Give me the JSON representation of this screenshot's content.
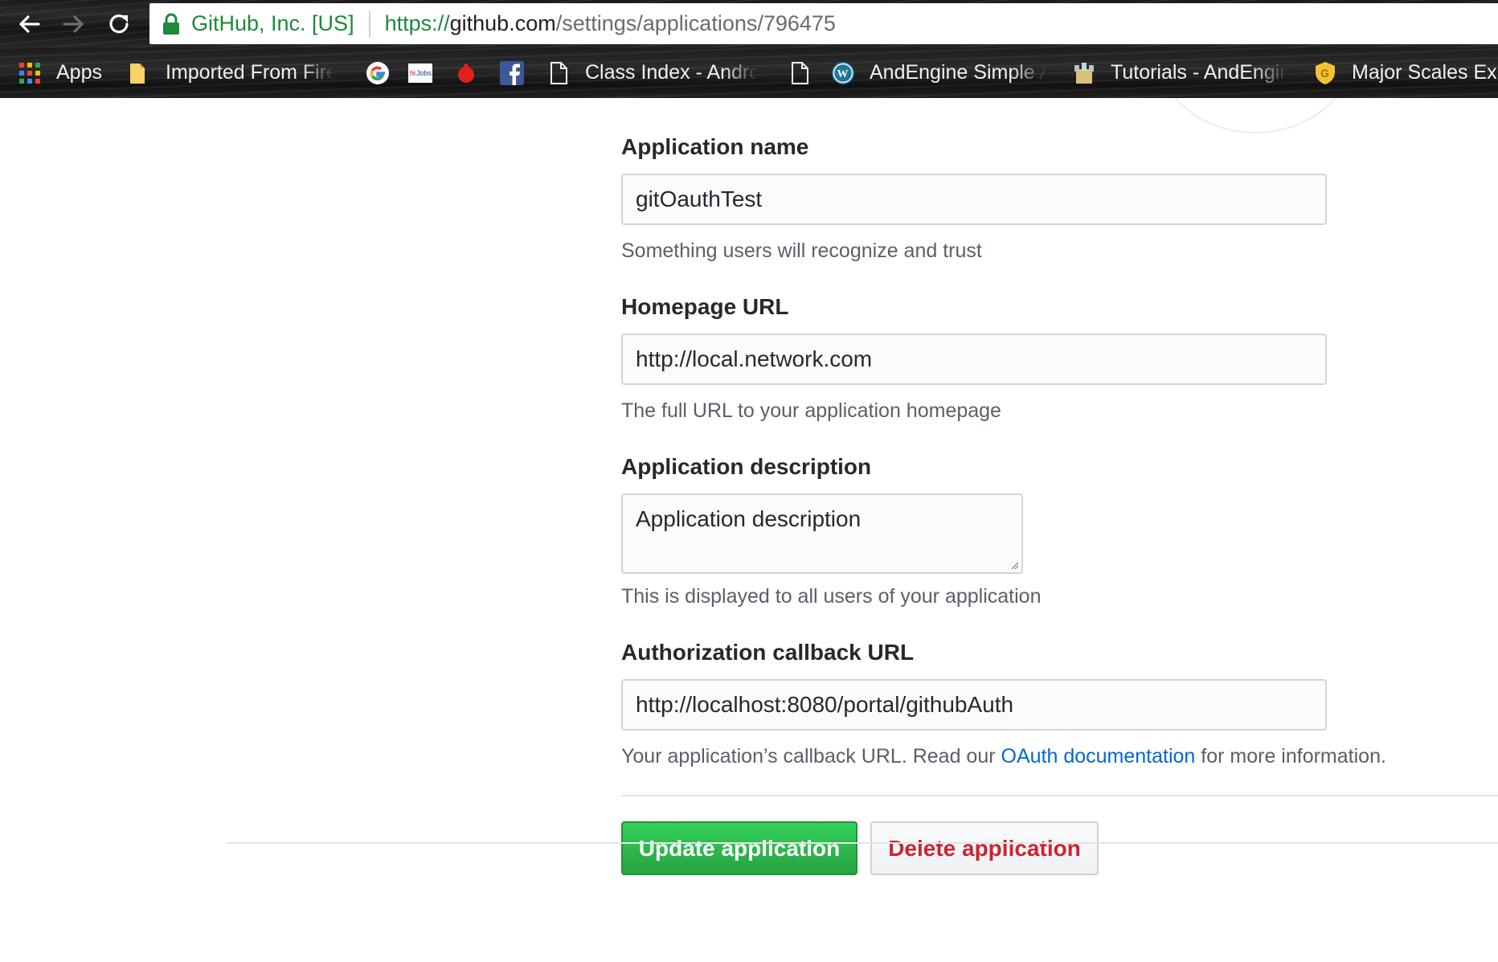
{
  "browser": {
    "site_identity": "GitHub, Inc. [US]",
    "url_scheme": "https://",
    "url_host": "github.com",
    "url_path": "/settings/applications/796475",
    "nav_icons": [
      "back-arrow-icon",
      "forward-arrow-icon",
      "reload-icon"
    ]
  },
  "bookmarks": [
    {
      "label": "Apps",
      "icon": "apps-grid-icon"
    },
    {
      "label": "Imported From Firef",
      "icon": "folder-icon"
    },
    {
      "label": "",
      "icon": "google-icon"
    },
    {
      "label": "",
      "icon": "indeed-jobs-icon"
    },
    {
      "label": "",
      "icon": "red-bug-icon"
    },
    {
      "label": "",
      "icon": "facebook-icon"
    },
    {
      "label": "Class Index - Androi",
      "icon": "page-icon"
    },
    {
      "label": "",
      "icon": "page-icon"
    },
    {
      "label": "AndEngine Simple A",
      "icon": "wordpress-icon"
    },
    {
      "label": "Tutorials - AndEngin",
      "icon": "castle-icon"
    },
    {
      "label": "Major Scales Exp",
      "icon": "shield-badge-icon"
    }
  ],
  "form": {
    "app_name_label": "Application name",
    "app_name_value": "gitOauthTest",
    "app_name_note": "Something users will recognize and trust",
    "homepage_label": "Homepage URL",
    "homepage_value": "http://local.network.com",
    "homepage_note": "The full URL to your application homepage",
    "description_label": "Application description",
    "description_placeholder": "Application description",
    "description_note": "This is displayed to all users of your application",
    "callback_label": "Authorization callback URL",
    "callback_value": "http://localhost:8080/portal/githubAuth",
    "callback_note_before": "Your application’s callback URL. Read our ",
    "callback_note_link": "OAuth documentation",
    "callback_note_after": " for more information."
  },
  "buttons": {
    "update": "Update application",
    "delete": "Delete application"
  },
  "colors": {
    "primary_green": "#28a745",
    "danger_red": "#cb2431",
    "link_blue": "#0366d6",
    "secure_green": "#1e8a3a"
  }
}
